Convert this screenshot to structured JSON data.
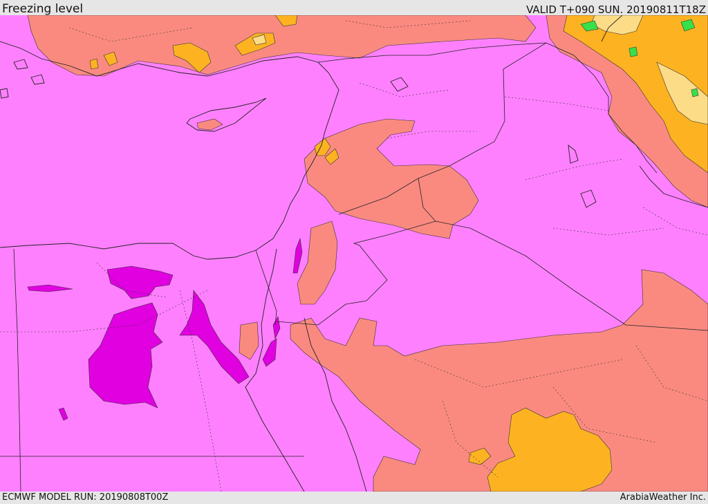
{
  "header": {
    "title": "Freezing level",
    "valid_time": "VALID T+090 SUN. 20190811T18Z"
  },
  "footer": {
    "model_run": "ECMWF MODEL RUN: 20190808T00Z",
    "credit": "ArabiaWeather Inc."
  },
  "map": {
    "region": "Eastern Mediterranean, Egypt, Levant, Iraq, northern Saudi Arabia",
    "colors": {
      "lowest_band": "#e000e0",
      "low_band": "#ff80ff",
      "mid_band": "#fa8a80",
      "upper_band": "#fdb321",
      "higher_band": "#fddc87",
      "highest_band": "#38e04a",
      "coastline": "#222222",
      "borders": "#222222"
    }
  }
}
